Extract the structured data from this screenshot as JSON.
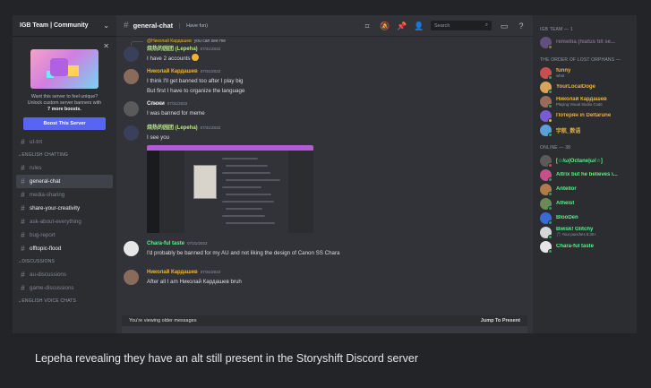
{
  "server": {
    "name": "IGB Team | Community",
    "boost": {
      "text_line1": "Want this server to feel unique?",
      "text_line2": "Unlock custom server banners with",
      "text_line3": "7 more boosts.",
      "button": "Boost This Server"
    },
    "channels_top": [
      {
        "label": "ut-tnt"
      }
    ],
    "categories": [
      {
        "title": "ENGLISH CHATTING",
        "channels": [
          {
            "label": "rules",
            "state": "muted"
          },
          {
            "label": "general-chat",
            "state": "active"
          },
          {
            "label": "media-sharing",
            "state": "muted"
          },
          {
            "label": "share-your-creativity",
            "state": "unread"
          },
          {
            "label": "ask-about-everything",
            "state": "muted"
          },
          {
            "label": "bug-report",
            "state": "muted"
          },
          {
            "label": "offtopic-flood",
            "state": "unread"
          }
        ]
      },
      {
        "title": "DISCUSSIONS",
        "channels": [
          {
            "label": "au-discussions",
            "state": "muted"
          },
          {
            "label": "game-discussions",
            "state": "muted"
          }
        ]
      },
      {
        "title": "ENGLISH VOICE CHATS",
        "channels": []
      }
    ]
  },
  "chat": {
    "channel": "general-chat",
    "topic": "Have fun)",
    "search_placeholder": "Search",
    "messages": [
      {
        "reply_to": "@Николай Кардашев",
        "reply_text": "you can see me",
        "author": "烧热的园团 (Lepeha)",
        "time": "07/31/2022",
        "color": "#b8e986",
        "lines": [
          "I have 2 accounts"
        ],
        "emoji": true
      },
      {
        "author": "Николай Кардашев",
        "time": "07/31/2022",
        "color": "#f0b232",
        "lines": [
          "I think I'll get banned too after I play big",
          "But first I have to organize the language"
        ]
      },
      {
        "author": "Спюки",
        "time": "07/31/2022",
        "color": "#f2f3f5",
        "lines": [
          "I was banned for meme"
        ]
      },
      {
        "author": "烧热的园团 (Lepeha)",
        "time": "07/31/2022",
        "color": "#b8e986",
        "lines": [
          "I see you"
        ],
        "image": true
      },
      {
        "author": "Chara-ful taste",
        "time": "07/31/2022",
        "color": "#57f287",
        "lines": [
          "I'd probably be banned for my AU and not liking the design of Canon SS Chara"
        ]
      },
      {
        "author": "Николай Кардашев",
        "time": "07/31/2022",
        "color": "#f0b232",
        "lines": [
          "After all I am Николай Кардашев bruh"
        ]
      }
    ],
    "older_bar": {
      "label": "You're viewing older messages",
      "jump": "Jump To Present"
    }
  },
  "members": {
    "groups": [
      {
        "title": "IGB TEAM — 1",
        "items": [
          {
            "name": "remellia (hiatus till se...",
            "status": "",
            "color": "#c39bd3",
            "dim": true,
            "avatar": "#8e6bbf",
            "dot": "#f0b232"
          }
        ]
      },
      {
        "title": "THE ORDER OF LOST ORPHANS —",
        "items": [
          {
            "name": "funny",
            "status": "what",
            "color": "#f0b232",
            "avatar": "#c94f4f",
            "dot": "#23a55a"
          },
          {
            "name": "YourLocalDoge",
            "status": "",
            "color": "#f0b232",
            "avatar": "#d6a45a",
            "dot": "#23a55a"
          },
          {
            "name": "Николай Кардашев",
            "status": "Playing Visual Studio Code",
            "color": "#f0b232",
            "avatar": "#9a6b5a",
            "dot": "#23a55a"
          },
          {
            "name": "Потерян in Deltarune",
            "status": "",
            "color": "#f0b232",
            "avatar": "#7a5bd6",
            "dot": "#f0b232"
          },
          {
            "name": "宇航_数语",
            "status": "",
            "color": "#f0b232",
            "avatar": "#5aa0d6",
            "dot": "#23a55a"
          }
        ]
      },
      {
        "title": "ONLINE — 38",
        "items": [
          {
            "name": "[☆/ω|Octane|ω/☆]",
            "status": "",
            "color": "#57f287",
            "avatar": "#5a5a5a",
            "dot": "#f23f43"
          },
          {
            "name": "Altrix but he believes i...",
            "status": "",
            "color": "#57f287",
            "avatar": "#c94f8a",
            "dot": "#23a55a"
          },
          {
            "name": "Antellor",
            "status": "",
            "color": "#57f287",
            "avatar": "#b07a4a",
            "dot": "#23a55a"
          },
          {
            "name": "Atheist",
            "status": "",
            "color": "#57f287",
            "avatar": "#6a8a5a",
            "dot": "#23a55a"
          },
          {
            "name": "BlooDen",
            "status": "",
            "color": "#57f287",
            "avatar": "#3a6ad6",
            "dot": "#23a55a"
          },
          {
            "name": "Bwisk! Glitchy",
            "status": "🎵 Your punches 5:30+",
            "color": "#57f287",
            "avatar": "#d6d6d6",
            "dot": "#23a55a"
          },
          {
            "name": "Chara-ful taste",
            "status": "",
            "color": "#57f287",
            "avatar": "#e6e6e6",
            "dot": "#23a55a"
          }
        ]
      }
    ]
  },
  "caption": "Lepeha revealing they have an alt still present in the Storyshift Discord server"
}
